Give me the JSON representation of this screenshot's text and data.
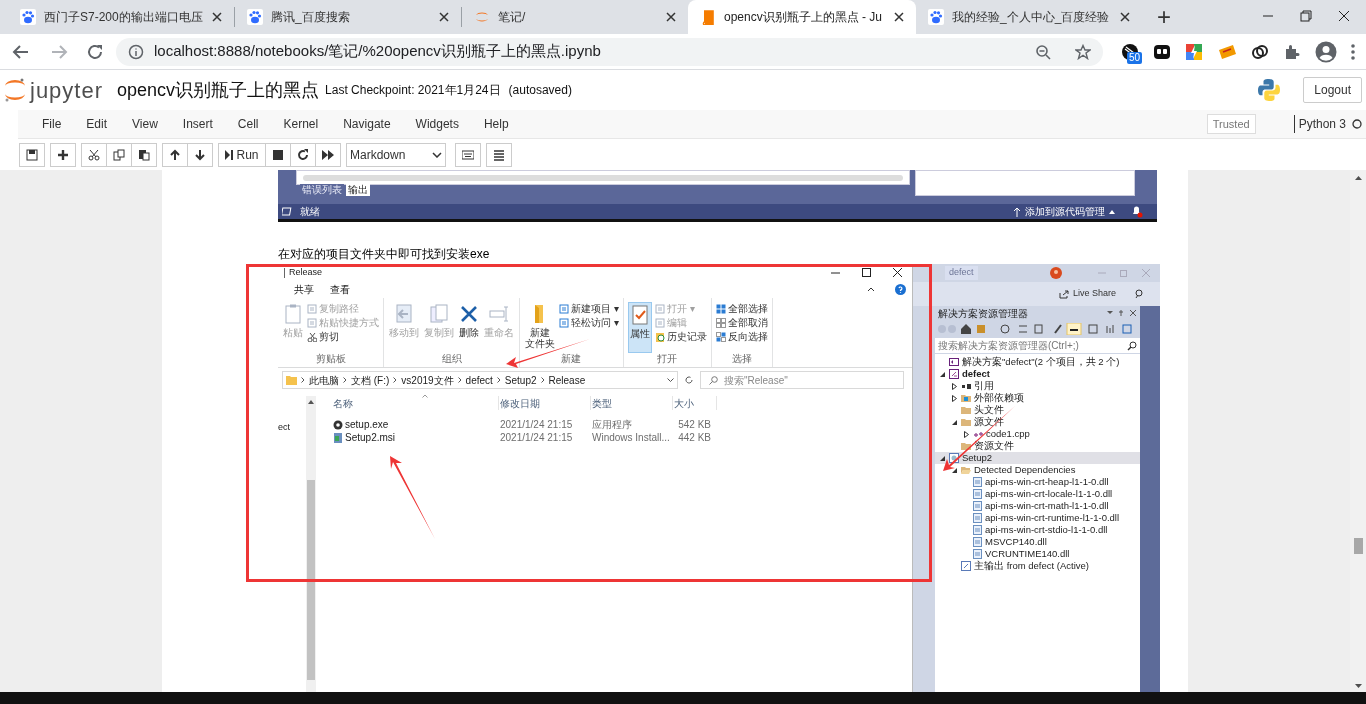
{
  "browser": {
    "tabs": [
      {
        "title": "西门子S7-200的输出端口电压",
        "kind": "paw",
        "selected": false
      },
      {
        "title": "腾讯_百度搜索",
        "kind": "paw",
        "selected": false
      },
      {
        "title": "笔记/",
        "kind": "jupyter",
        "selected": false
      },
      {
        "title": "opencv识别瓶子上的黑点 - Ju",
        "kind": "book",
        "selected": true
      },
      {
        "title": "我的经验_个人中心_百度经验",
        "kind": "paw",
        "selected": false
      }
    ],
    "new_tab": "+",
    "address": "localhost:8888/notebooks/笔记/%20opencv识别瓶子上的黑点.ipynb",
    "extension_badge": "50"
  },
  "jupyter": {
    "logo": "jupyter",
    "notebook_title": "opencv识别瓶子上的黑点",
    "checkpoint": "Last Checkpoint: 2021年1月24日",
    "autosave": "(autosaved)",
    "logout": "Logout",
    "menu": [
      "File",
      "Edit",
      "View",
      "Insert",
      "Cell",
      "Kernel",
      "Navigate",
      "Widgets",
      "Help"
    ],
    "trusted": "Trusted",
    "kernel": "Python 3",
    "kernel_busy": false,
    "run": "Run",
    "cell_type": "Markdown"
  },
  "output_image_1": {
    "tabs": [
      {
        "label": "错误列表",
        "selected": false
      },
      {
        "label": "输出",
        "selected": true
      }
    ],
    "status": "就绪",
    "source_control": "添加到源代码管理"
  },
  "markdown": "在对应的项目文件夹中即可找到安装exe",
  "output_image_2": {
    "explorer": {
      "title": "Release",
      "ribbon_tabs": [
        "共享",
        "查看"
      ],
      "groups": [
        {
          "label": "剪贴板",
          "large": [
            {
              "label": "粘贴",
              "kind": "clipboard",
              "disabled": true,
              "selected": false
            }
          ],
          "small": [
            {
              "label": "复制路径",
              "kind": "path",
              "disabled": true
            },
            {
              "label": "粘贴快捷方式",
              "kind": "shortcut",
              "disabled": true
            },
            {
              "label": "剪切",
              "kind": "scissors",
              "disabled": false
            }
          ]
        },
        {
          "label": "组织",
          "large": [
            {
              "label": "移动到",
              "kind": "move",
              "disabled": true,
              "selected": false
            },
            {
              "label": "复制到",
              "kind": "copy",
              "disabled": true,
              "selected": false
            },
            {
              "label": "删除",
              "kind": "delete",
              "disabled": false,
              "selected": false
            },
            {
              "label": "重命名",
              "kind": "rename",
              "disabled": true,
              "selected": false
            }
          ]
        },
        {
          "label": "新建",
          "large": [
            {
              "label": "新建",
              "sublabel": "文件夹",
              "kind": "folder",
              "disabled": false,
              "selected": false
            }
          ],
          "small": [
            {
              "label": "新建项目 ▾",
              "kind": "newitem",
              "disabled": false
            },
            {
              "label": "轻松访问 ▾",
              "kind": "access",
              "disabled": false
            }
          ]
        },
        {
          "label": "打开",
          "large": [
            {
              "label": "属性",
              "kind": "properties",
              "disabled": false,
              "selected": true
            }
          ],
          "small": [
            {
              "label": "打开 ▾",
              "kind": "open",
              "disabled": true
            },
            {
              "label": "编辑",
              "kind": "edit",
              "disabled": true
            },
            {
              "label": "历史记录",
              "kind": "history",
              "disabled": false
            }
          ]
        },
        {
          "label": "选择",
          "small": [
            {
              "label": "全部选择",
              "kind": "selectall",
              "disabled": false
            },
            {
              "label": "全部取消",
              "kind": "selectnone",
              "disabled": false
            },
            {
              "label": "反向选择",
              "kind": "invert",
              "disabled": false
            }
          ]
        }
      ],
      "breadcrumb": [
        "此电脑",
        "文档 (F:)",
        "vs2019文件",
        "defect",
        "Setup2",
        "Release"
      ],
      "search_placeholder": "搜索\"Release\"",
      "nav_fragment": "ect",
      "columns": [
        "名称",
        "修改日期",
        "类型",
        "大小"
      ],
      "rows": [
        {
          "kind": "exe",
          "cells": [
            "setup.exe",
            "2021/1/24 21:15",
            "应用程序",
            "542 KB"
          ]
        },
        {
          "kind": "msi",
          "cells": [
            "Setup2.msi",
            "2021/1/24 21:15",
            "Windows Install...",
            "442 KB"
          ]
        }
      ]
    },
    "visual_studio": {
      "title": "defect",
      "live_share": "Live Share",
      "panel_title": "解决方案资源管理器",
      "search_placeholder": "搜索解决方案资源管理器(Ctrl+;)",
      "tree": [
        {
          "label": "解决方案\"defect\"(2 个项目，共 2 个)",
          "kind": "solution",
          "selected": false,
          "children": [
            {
              "label": "defect",
              "kind": "project",
              "selected": false,
              "expanded": true,
              "children": [
                {
                  "label": "引用",
                  "kind": "references",
                  "selected": false,
                  "expanded": false
                },
                {
                  "label": "外部依赖项",
                  "kind": "external",
                  "selected": false,
                  "expanded": false
                },
                {
                  "label": "头文件",
                  "kind": "folder",
                  "selected": false
                },
                {
                  "label": "源文件",
                  "kind": "folder",
                  "selected": false,
                  "expanded": true,
                  "children": [
                    {
                      "label": "code1.cpp",
                      "kind": "cpp",
                      "selected": false,
                      "expanded": false
                    }
                  ]
                },
                {
                  "label": "资源文件",
                  "kind": "folder",
                  "selected": false
                }
              ]
            },
            {
              "label": "Setup2",
              "kind": "setup",
              "selected": true,
              "expanded": true,
              "children": [
                {
                  "label": "Detected Dependencies",
                  "kind": "openfolder",
                  "selected": false,
                  "expanded": true,
                  "children": [
                    {
                      "label": "api-ms-win-crt-heap-l1-1-0.dll",
                      "kind": "dll",
                      "selected": false
                    },
                    {
                      "label": "api-ms-win-crt-locale-l1-1-0.dll",
                      "kind": "dll",
                      "selected": false
                    },
                    {
                      "label": "api-ms-win-crt-math-l1-1-0.dll",
                      "kind": "dll",
                      "selected": false
                    },
                    {
                      "label": "api-ms-win-crt-runtime-l1-1-0.dll",
                      "kind": "dll",
                      "selected": false
                    },
                    {
                      "label": "api-ms-win-crt-stdio-l1-1-0.dll",
                      "kind": "dll",
                      "selected": false
                    },
                    {
                      "label": "MSVCP140.dll",
                      "kind": "dll",
                      "selected": false
                    },
                    {
                      "label": "VCRUNTIME140.dll",
                      "kind": "dll",
                      "selected": false
                    }
                  ]
                },
                {
                  "label": "主输出 from defect (Active)",
                  "kind": "output",
                  "selected": false
                }
              ]
            }
          ]
        }
      ]
    }
  }
}
